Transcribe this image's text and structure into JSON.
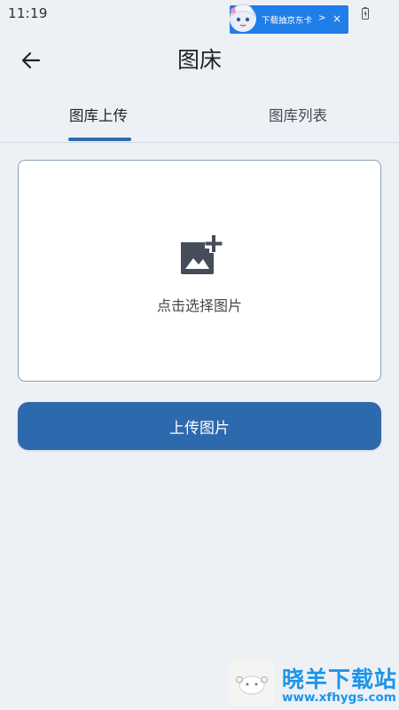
{
  "status_bar": {
    "time": "11:19",
    "ad_text": "下载抽京东卡",
    "ad_chevron": ">",
    "ad_close": "×"
  },
  "header": {
    "title": "图床"
  },
  "tabs": [
    {
      "label": "图库上传",
      "active": true
    },
    {
      "label": "图库列表",
      "active": false
    }
  ],
  "upload_area": {
    "hint": "点击选择图片"
  },
  "actions": {
    "upload_label": "上传图片"
  },
  "watermark": {
    "brand": "晓羊下载站",
    "url": "www.xfhygs.com"
  },
  "colors": {
    "accent": "#2d69ad",
    "background": "#edf1f6",
    "ad_blue": "#1f7ee8",
    "watermark_blue": "#1e94e8"
  }
}
